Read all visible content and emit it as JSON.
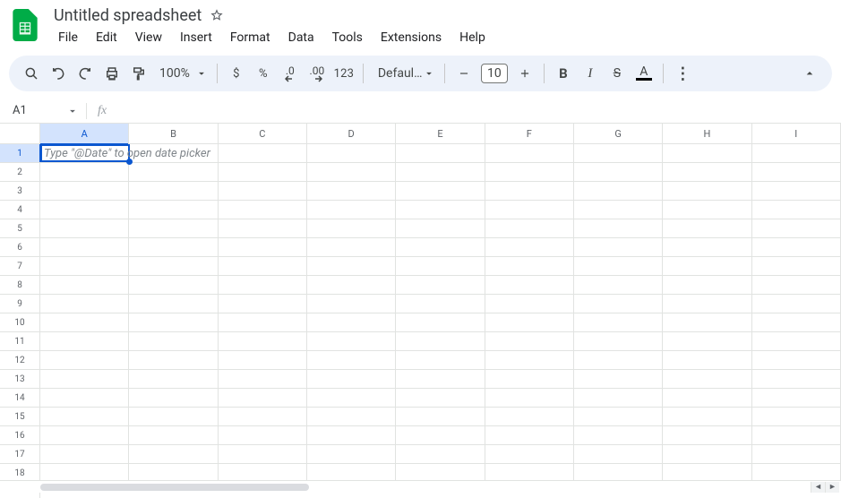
{
  "header": {
    "title": "Untitled spreadsheet",
    "menus": [
      "File",
      "Edit",
      "View",
      "Insert",
      "Format",
      "Data",
      "Tools",
      "Extensions",
      "Help"
    ]
  },
  "toolbar": {
    "zoom": "100%",
    "currency": "$",
    "percent": "%",
    "dec_dec": ".0",
    "dec_inc": ".00",
    "num_fmt": "123",
    "font": "Defaul...",
    "font_size": "10",
    "bold": "B",
    "italic": "I",
    "strike": "S",
    "text_color_letter": "A"
  },
  "namebox": {
    "ref": "A1"
  },
  "grid": {
    "columns": [
      "A",
      "B",
      "C",
      "D",
      "E",
      "F",
      "G",
      "H",
      "I"
    ],
    "rows": [
      "1",
      "2",
      "3",
      "4",
      "5",
      "6",
      "7",
      "8",
      "9",
      "10",
      "11",
      "12",
      "13",
      "14",
      "15",
      "16",
      "17",
      "18"
    ],
    "active_cell_placeholder": "Type \"@Date\" to open date picker"
  }
}
